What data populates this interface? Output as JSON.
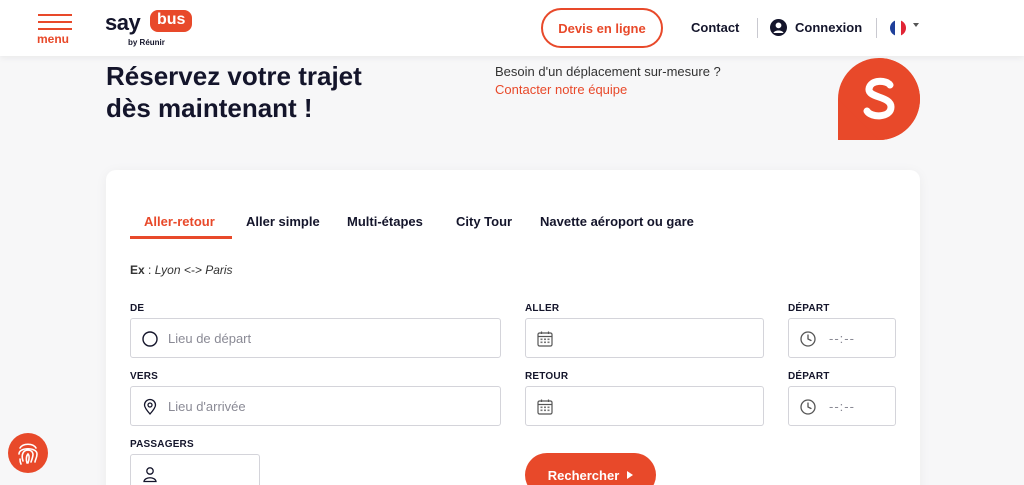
{
  "header": {
    "menu_label": "menu",
    "logo": {
      "say": "say",
      "bus": "bus",
      "by": "by Réunir"
    },
    "quote_button": "Devis en ligne",
    "contact": "Contact",
    "login": "Connexion",
    "language_flag": "fr-flag-icon"
  },
  "hero": {
    "title_line1": "Réservez votre trajet",
    "title_line2": "dès maintenant !",
    "help_text": "Besoin d'un déplacement sur-mesure ?",
    "help_link": "Contacter notre équipe"
  },
  "booking": {
    "tabs": [
      "Aller-retour",
      "Aller simple",
      "Multi-étapes",
      "City Tour",
      "Navette aéroport ou gare"
    ],
    "active_tab": 0,
    "example_prefix": "Ex",
    "example_text": "Lyon <-> Paris",
    "from_label": "DE",
    "from_placeholder": "Lieu de départ",
    "to_label": "VERS",
    "to_placeholder": "Lieu d'arrivée",
    "outbound_label": "ALLER",
    "return_label": "RETOUR",
    "departure_label_1": "DÉPART",
    "departure_label_2": "DÉPART",
    "time_placeholder": "--:--",
    "passengers_label": "PASSAGERS",
    "search_button": "Rechercher"
  },
  "colors": {
    "accent": "#e8492a",
    "text": "#14152b"
  }
}
